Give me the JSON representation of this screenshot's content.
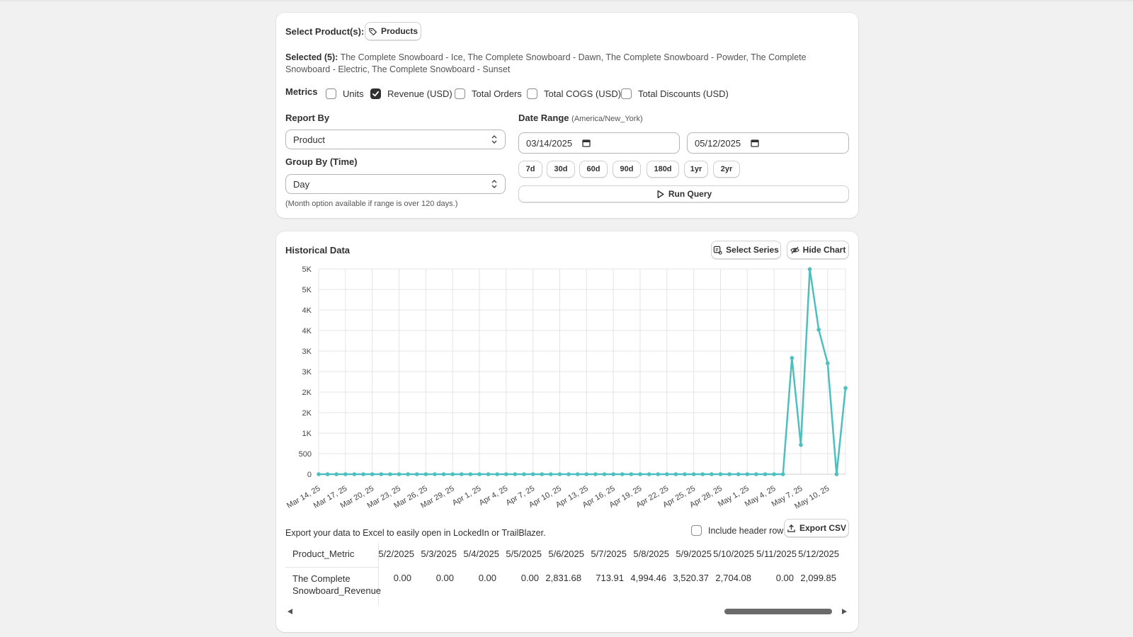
{
  "filters": {
    "select_products_label": "Select Product(s):",
    "products_button": "Products",
    "selected_label": "Selected (5):",
    "selected_text": "The Complete Snowboard - Ice, The Complete Snowboard - Dawn, The Complete Snowboard - Powder, The Complete Snowboard - Electric, The Complete Snowboard - Sunset",
    "metrics_label": "Metrics",
    "metrics": [
      {
        "label": "Units",
        "checked": false
      },
      {
        "label": "Revenue (USD)",
        "checked": true
      },
      {
        "label": "Total Orders",
        "checked": false
      },
      {
        "label": "Total COGS (USD)",
        "checked": false
      },
      {
        "label": "Total Discounts (USD)",
        "checked": false
      }
    ],
    "report_by_label": "Report By",
    "report_by_value": "Product",
    "group_by_label": "Group By (Time)",
    "group_by_value": "Day",
    "group_by_help": "(Month option available if range is over 120 days.)",
    "date_range_label": "Date Range",
    "date_range_tz": "(America/New_York)",
    "start_date": "03/14/2025",
    "end_date": "05/12/2025",
    "presets": [
      "7d",
      "30d",
      "60d",
      "90d",
      "180d",
      "1yr",
      "2yr"
    ],
    "run_query": "Run Query"
  },
  "historical": {
    "title": "Historical Data",
    "select_series": "Select Series",
    "hide_chart": "Hide Chart",
    "export_text": "Export your data to Excel to easily open in LockedIn or TrailBlazer.",
    "include_header": "Include header row",
    "export_csv": "Export CSV",
    "table": {
      "header_first": "Product_Metric",
      "row_label_line1": "The Complete",
      "row_label_line2": "Snowboard_Revenue",
      "columns": [
        "5/2/2025",
        "5/3/2025",
        "5/4/2025",
        "5/5/2025",
        "5/6/2025",
        "5/7/2025",
        "5/8/2025",
        "5/9/2025",
        "5/10/2025",
        "5/11/2025",
        "5/12/2025"
      ],
      "values": [
        "0.00",
        "0.00",
        "0.00",
        "0.00",
        "2,831.68",
        "713.91",
        "4,994.46",
        "3,520.37",
        "2,704.08",
        "0.00",
        "2,099.85"
      ]
    }
  },
  "chart_data": {
    "type": "line",
    "y_tick_labels": [
      "0",
      "500",
      "1K",
      "2K",
      "2K",
      "3K",
      "3K",
      "4K",
      "4K",
      "5K",
      "5K"
    ],
    "ylim": [
      0,
      5000
    ],
    "x_tick_labels": [
      "Mar 14, 25",
      "Mar 17, 25",
      "Mar 20, 25",
      "Mar 23, 25",
      "Mar 26, 25",
      "Mar 29, 25",
      "Apr 1, 25",
      "Apr 4, 25",
      "Apr 7, 25",
      "Apr 10, 25",
      "Apr 13, 25",
      "Apr 16, 25",
      "Apr 19, 25",
      "Apr 22, 25",
      "Apr 25, 25",
      "Apr 28, 25",
      "May 1, 25",
      "May 4, 25",
      "May 7, 25",
      "May 10, 25"
    ],
    "grid": true,
    "line_color": "#4dbfbf",
    "series": [
      {
        "values": [
          0,
          0,
          0,
          0,
          0,
          0,
          0,
          0,
          0,
          0,
          0,
          0,
          0,
          0,
          0,
          0,
          0,
          0,
          0,
          0,
          0,
          0,
          0,
          0,
          0,
          0,
          0,
          0,
          0,
          0,
          0,
          0,
          0,
          0,
          0,
          0,
          0,
          0,
          0,
          0,
          0,
          0,
          0,
          0,
          0,
          0,
          0,
          0,
          0,
          0,
          0,
          0,
          0,
          2831.68,
          713.91,
          4994.46,
          3520.37,
          2704.08,
          0,
          2099.85
        ]
      }
    ]
  }
}
